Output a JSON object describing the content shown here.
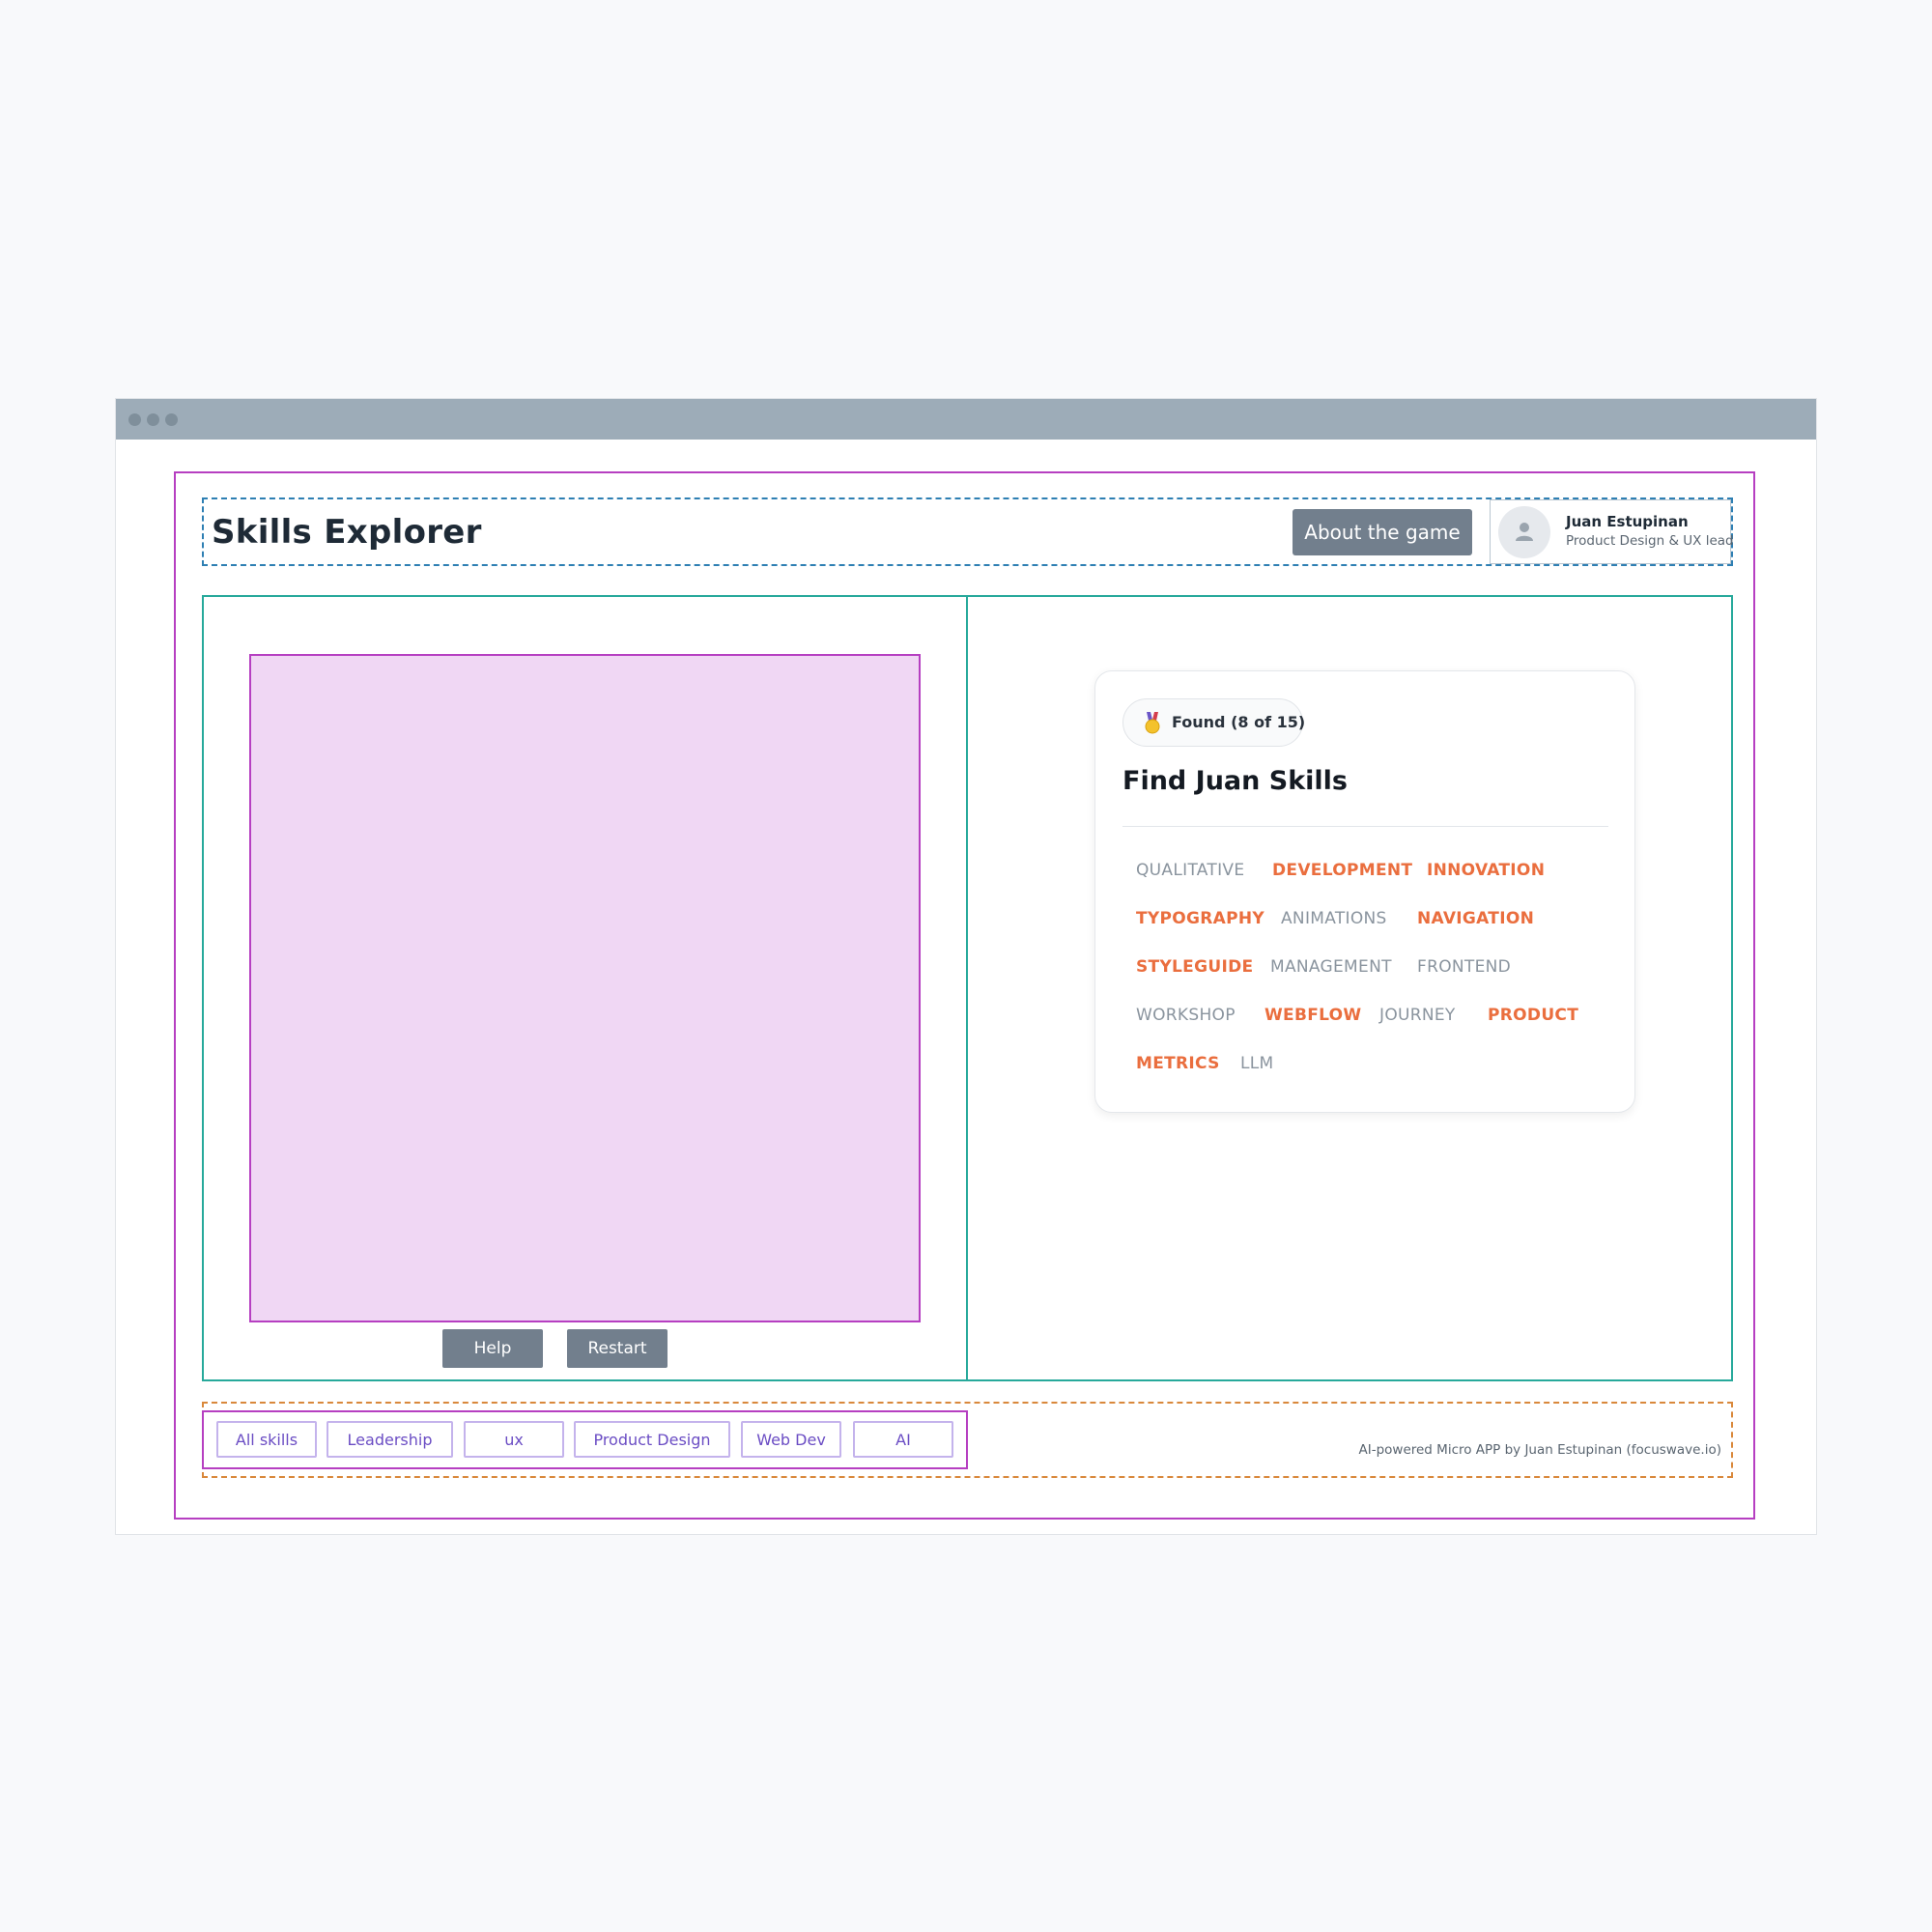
{
  "app": {
    "title": "Skills Explorer",
    "about_label": "About the game"
  },
  "profile": {
    "name": "Juan Estupinan",
    "role": "Product Design & UX lead",
    "avatar_icon": "user-icon"
  },
  "controls": {
    "help_label": "Help",
    "restart_label": "Restart"
  },
  "card": {
    "badge_icon": "medal-icon",
    "found_label": "Found (8 of 15)",
    "title": "Find Juan Skills",
    "skills": [
      {
        "label": "QUALITATIVE",
        "found": false
      },
      {
        "label": "DEVELOPMENT",
        "found": true
      },
      {
        "label": "INNOVATION",
        "found": true
      },
      {
        "label": "TYPOGRAPHY",
        "found": true
      },
      {
        "label": "ANIMATIONS",
        "found": false
      },
      {
        "label": "NAVIGATION",
        "found": true
      },
      {
        "label": "STYLEGUIDE",
        "found": true
      },
      {
        "label": "MANAGEMENT",
        "found": false
      },
      {
        "label": "FRONTEND",
        "found": false
      },
      {
        "label": "WORKSHOP",
        "found": false
      },
      {
        "label": "WEBFLOW",
        "found": true
      },
      {
        "label": "JOURNEY",
        "found": false
      },
      {
        "label": "PRODUCT",
        "found": true
      },
      {
        "label": "METRICS",
        "found": true
      },
      {
        "label": "LLM",
        "found": false
      }
    ]
  },
  "filters": [
    {
      "label": "All skills"
    },
    {
      "label": "Leadership"
    },
    {
      "label": "ux"
    },
    {
      "label": "Product Design"
    },
    {
      "label": "Web Dev"
    },
    {
      "label": "AI"
    }
  ],
  "footer": {
    "credit": "AI-powered Micro APP by Juan Estupinan (focuswave.io)"
  },
  "colors": {
    "found": "#ea6e3e",
    "missing": "#8a949e",
    "accent_frame": "#b63fc1",
    "panel_border": "#27a99b"
  }
}
